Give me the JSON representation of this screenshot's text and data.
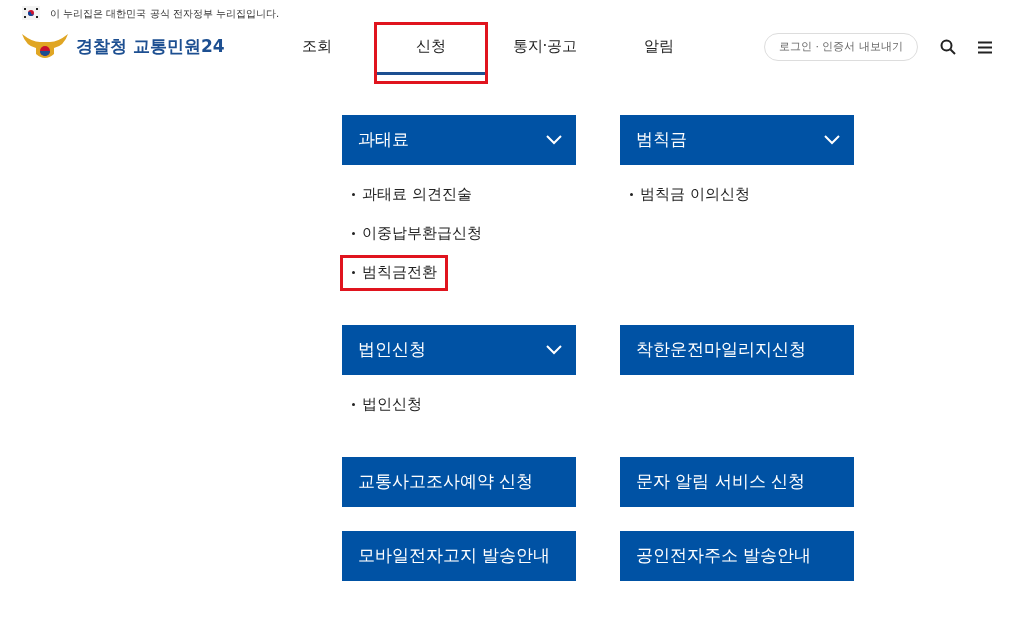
{
  "gov_banner": {
    "text": "이 누리집은 대한민국 공식 전자정부 누리집입니다."
  },
  "header": {
    "logo_text": "경찰청 교통민원24",
    "nav": [
      {
        "label": "조회",
        "selected": false,
        "highlighted": false
      },
      {
        "label": "신청",
        "selected": true,
        "highlighted": true
      },
      {
        "label": "통지·공고",
        "selected": false,
        "highlighted": false
      },
      {
        "label": "알림",
        "selected": false,
        "highlighted": false
      }
    ],
    "login_button": "로그인 · 인증서 내보내기"
  },
  "menu_sections": [
    {
      "title": "과태료",
      "expandable": true,
      "items": [
        {
          "label": "과태료 의견진술",
          "highlighted": false
        },
        {
          "label": "이중납부환급신청",
          "highlighted": false
        },
        {
          "label": "범칙금전환",
          "highlighted": true
        }
      ]
    },
    {
      "title": "범칙금",
      "expandable": true,
      "items": [
        {
          "label": "범칙금 이의신청",
          "highlighted": false
        }
      ]
    },
    {
      "title": "법인신청",
      "expandable": true,
      "items": [
        {
          "label": "법인신청",
          "highlighted": false
        }
      ]
    },
    {
      "title": "착한운전마일리지신청",
      "expandable": false
    },
    {
      "title": "교통사고조사예약 신청",
      "expandable": false
    },
    {
      "title": "문자 알림 서비스 신청",
      "expandable": false
    },
    {
      "title": "모바일전자고지 발송안내",
      "expandable": false
    },
    {
      "title": "공인전자주소 발송안내",
      "expandable": false
    }
  ]
}
